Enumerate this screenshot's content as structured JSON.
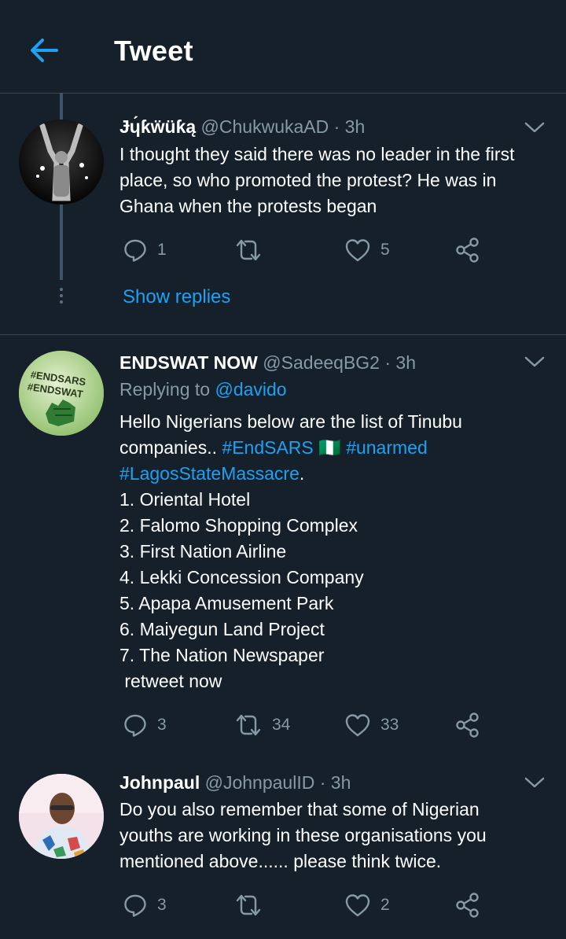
{
  "header": {
    "title": "Tweet"
  },
  "tweets": [
    {
      "name": "Ɉɥ́ƙẅüƙą",
      "handle": "@ChukwukaAD",
      "time": "· 3h",
      "text_lines": [
        "I thought they said there was no leader in the first",
        "place, so who promoted the protest? He was in",
        "Ghana when the protests began"
      ],
      "replies": "1",
      "retweets": "",
      "likes": "5",
      "show_replies": "Show replies"
    },
    {
      "name": "ENDSWAT NOW",
      "handle": "@SadeeqBG2",
      "time": "· 3h",
      "replying_to_label": "Replying to",
      "replying_to_user": "@davido",
      "intro_1": "Hello Nigerians below are the list of Tinubu",
      "intro_2": "companies..",
      "tag_endsars": "#EndSARS",
      "flag_emoji": "🇳🇬",
      "tag_unarmed": "#unarmed",
      "tag_massacre": "#LagosStateMassacre",
      "period": ".",
      "list": [
        "1. Oriental Hotel",
        "2. Falomo Shopping Complex",
        "3. First Nation Airline",
        "4. Lekki Concession Company",
        "5. Apapa Amusement Park",
        "6. Maiyegun Land Project",
        "7. The Nation Newspaper"
      ],
      "outro": " retweet now",
      "avatar_text_1": "#ENDSARS",
      "avatar_text_2": "#ENDSWAT",
      "replies": "3",
      "retweets": "34",
      "likes": "33"
    },
    {
      "name": "Johnpaul",
      "handle": "@JohnpaulID",
      "time": "· 3h",
      "text_lines": [
        "Do you also remember that some of Nigerian",
        "youths are working in these organisations you",
        "mentioned above...... please think twice."
      ],
      "replies": "3",
      "retweets": "",
      "likes": "2"
    }
  ],
  "colors": {
    "background": "#15202b",
    "accent": "#1da1f2",
    "muted": "#8899a6",
    "divider": "#38444d"
  },
  "icons": [
    "back-arrow-icon",
    "chevron-down-icon",
    "reply-icon",
    "retweet-icon",
    "like-icon",
    "share-icon"
  ]
}
